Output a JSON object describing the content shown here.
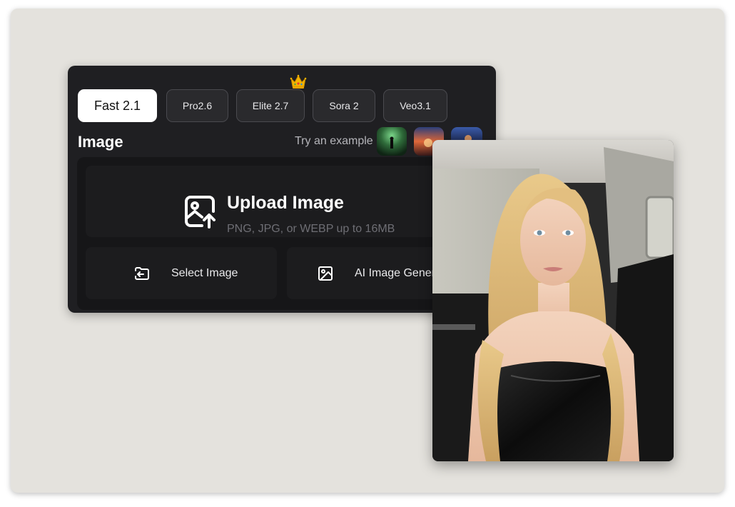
{
  "tabs": [
    {
      "label": "Fast 2.1",
      "active": true
    },
    {
      "label": "Pro2.6",
      "active": false
    },
    {
      "label": "Elite 2.7",
      "active": false
    },
    {
      "label": "Sora 2",
      "active": false
    },
    {
      "label": "Veo3.1",
      "active": false
    }
  ],
  "premium_badge_icon": "crown-icon",
  "section": {
    "title": "Image",
    "try_example_label": "Try an example",
    "examples": [
      "example-thumbnail-dark-forest",
      "example-thumbnail-sunset",
      "example-thumbnail-city-night"
    ]
  },
  "upload": {
    "title": "Upload Image",
    "subtitle": "PNG, JPG, or WEBP up to 16MB",
    "icon": "image-upload-icon"
  },
  "actions": {
    "select_image_label": "Select Image",
    "select_image_icon": "folder-import-icon",
    "ai_image_label": "AI Image Gener",
    "ai_image_icon": "image-icon"
  },
  "preview": {
    "subject": "preview-photo"
  },
  "colors": {
    "canvas_bg": "#e4e2dd",
    "panel_bg": "#1f1f22",
    "active_tab_bg": "#ffffff",
    "tab_border": "#4a4a4f"
  }
}
